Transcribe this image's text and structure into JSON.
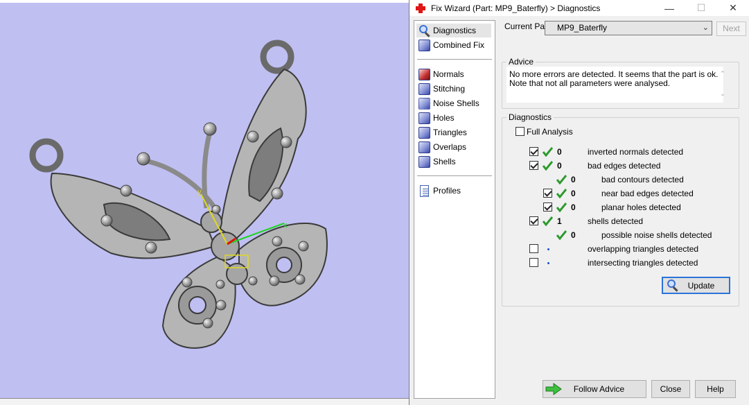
{
  "window": {
    "title": "Fix Wizard (Part: MP9_Baterfly) > Diagnostics",
    "minimize": "—",
    "maximize": "☐",
    "close": "✕"
  },
  "nav": {
    "items": [
      {
        "label": "Diagnostics",
        "icon": "magnifier-icon"
      },
      {
        "label": "Combined Fix",
        "icon": "cube-icon"
      },
      {
        "label": "Normals",
        "icon": "cube-red-icon"
      },
      {
        "label": "Stitching",
        "icon": "cube-stitch-icon"
      },
      {
        "label": "Noise Shells",
        "icon": "noise-shells-icon"
      },
      {
        "label": "Holes",
        "icon": "cube-holes-icon"
      },
      {
        "label": "Triangles",
        "icon": "triangles-icon"
      },
      {
        "label": "Overlaps",
        "icon": "overlaps-icon"
      },
      {
        "label": "Shells",
        "icon": "shells-icon"
      },
      {
        "label": "Profiles",
        "icon": "document-icon"
      }
    ]
  },
  "current_part": {
    "label": "Current Part:",
    "value": "MP9_Baterfly",
    "next_label": "Next"
  },
  "advice": {
    "title": "Advice",
    "text_line1": "No more errors are detected. It seems that the part is ok.",
    "text_line2": "Note that not all parameters were analysed."
  },
  "diagnostics": {
    "title": "Diagnostics",
    "full_analysis_label": "Full Analysis",
    "full_analysis_checked": false,
    "rows": [
      {
        "checked": true,
        "status": "ok",
        "count": "0",
        "label": "inverted normals detected",
        "indent": 0
      },
      {
        "checked": true,
        "status": "ok",
        "count": "0",
        "label": "bad edges detected",
        "indent": 0
      },
      {
        "checked": null,
        "status": "ok",
        "count": "0",
        "label": "bad contours detected",
        "indent": 1
      },
      {
        "checked": true,
        "status": "ok",
        "count": "0",
        "label": "near bad edges detected",
        "indent": 1
      },
      {
        "checked": true,
        "status": "ok",
        "count": "0",
        "label": "planar holes detected",
        "indent": 1
      },
      {
        "checked": true,
        "status": "ok",
        "count": "1",
        "label": "shells detected",
        "indent": 0
      },
      {
        "checked": null,
        "status": "ok",
        "count": "0",
        "label": "possible noise shells detected",
        "indent": 1
      },
      {
        "checked": false,
        "status": "not-run",
        "count": "",
        "label": "overlapping triangles detected",
        "indent": 0
      },
      {
        "checked": false,
        "status": "not-run",
        "count": "",
        "label": "intersecting triangles detected",
        "indent": 0
      }
    ],
    "update_label": "Update"
  },
  "footer": {
    "follow_advice_label": "Follow Advice",
    "close_label": "Close",
    "help_label": "Help"
  },
  "viewport": {
    "axis_x": "x",
    "axis_y": "y"
  },
  "colors": {
    "viewport_bg": "#bfbff2",
    "check_green": "#2d9a2d",
    "focus_blue": "#2a73d9"
  }
}
